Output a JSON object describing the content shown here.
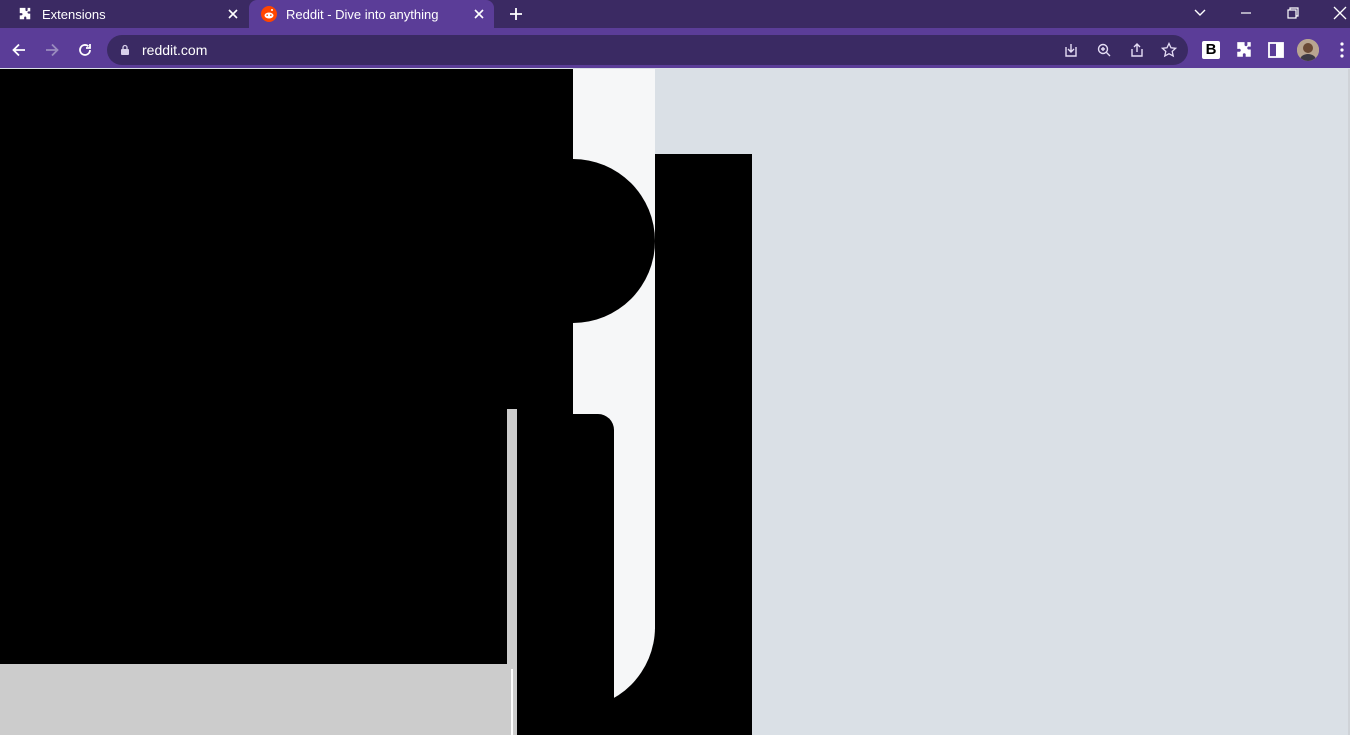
{
  "browser": {
    "tabs": [
      {
        "label": "Extensions",
        "icon": "puzzle-icon",
        "active": false
      },
      {
        "label": "Reddit - Dive into anything",
        "icon": "reddit-icon",
        "active": true
      }
    ],
    "new_tab_icon": "plus-icon",
    "window_controls": [
      "tab-search-icon",
      "minimize-icon",
      "restore-icon",
      "close-icon"
    ],
    "toolbar": {
      "back_icon": "back-arrow-icon",
      "forward_icon": "forward-arrow-icon",
      "reload_icon": "reload-icon",
      "lock_icon": "lock-icon",
      "url": "reddit.com",
      "omnibox_icons": [
        "install-app-icon",
        "zoom-icon",
        "share-icon",
        "bookmark-star-icon"
      ],
      "extension_letter": "B",
      "extensions_icon": "puzzle-icon",
      "side_panel_icon": "side-panel-icon",
      "profile_icon": "avatar",
      "menu_icon": "kebab-menu-icon"
    },
    "colors": {
      "tabstrip": "#3b2a63",
      "toolbar": "#5b3d98",
      "page_background": "#dae0e6",
      "reddit_orange": "#ff4500"
    }
  }
}
